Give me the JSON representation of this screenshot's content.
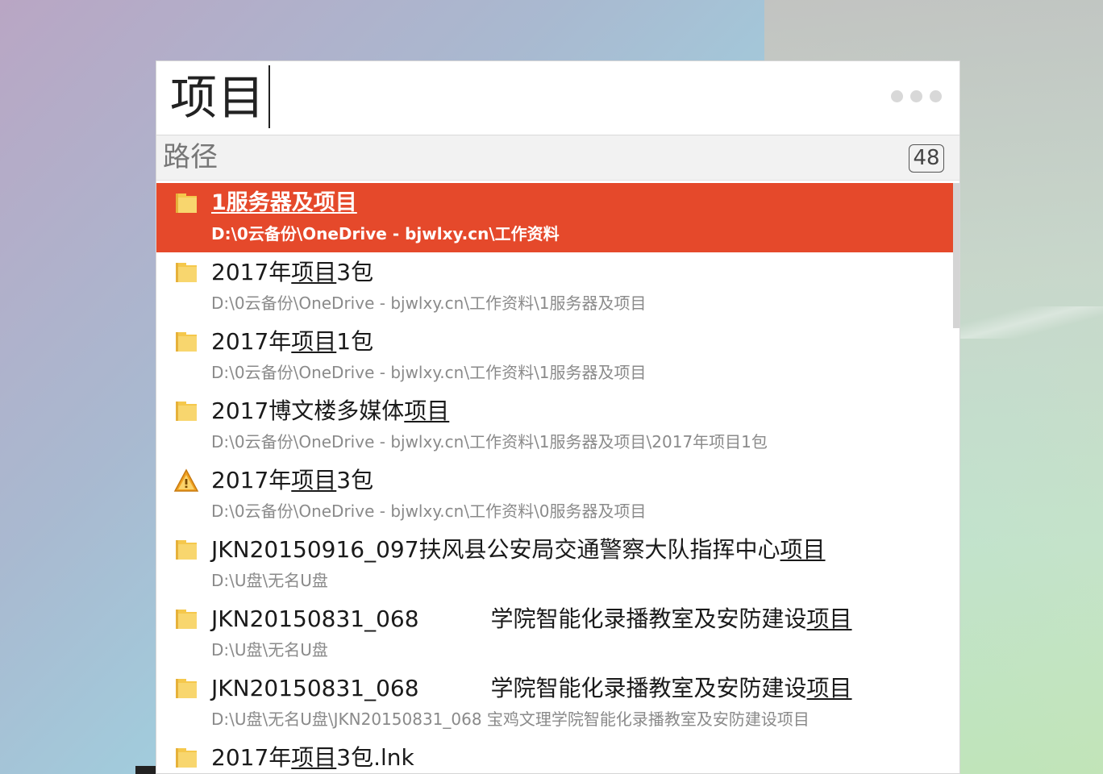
{
  "search": {
    "query": "项目"
  },
  "category": {
    "label": "路径",
    "count": "48"
  },
  "colors": {
    "selected_bg": "#e5492b",
    "folder_yellow": "#f5c84c",
    "warning_orange": "#f0a020"
  },
  "results": [
    {
      "icon": "folder-icon",
      "title_before": "",
      "title_match": "1服务器及项目",
      "title_after": "",
      "path": "D:\\0云备份\\OneDrive - bjwlxy.cn\\工作资料",
      "selected": true
    },
    {
      "icon": "folder-icon",
      "title_before": "2017年",
      "title_match": "项目",
      "title_after": "3包",
      "path": "D:\\0云备份\\OneDrive - bjwlxy.cn\\工作资料\\1服务器及项目"
    },
    {
      "icon": "folder-icon",
      "title_before": "2017年",
      "title_match": "项目",
      "title_after": "1包",
      "path": "D:\\0云备份\\OneDrive - bjwlxy.cn\\工作资料\\1服务器及项目"
    },
    {
      "icon": "folder-icon",
      "title_before": "2017博文楼多媒体",
      "title_match": "项目",
      "title_after": "",
      "path": "D:\\0云备份\\OneDrive - bjwlxy.cn\\工作资料\\1服务器及项目\\2017年项目1包"
    },
    {
      "icon": "warning-icon",
      "title_before": "2017年",
      "title_match": "项目",
      "title_after": "3包",
      "path": "D:\\0云备份\\OneDrive - bjwlxy.cn\\工作资料\\0服务器及项目"
    },
    {
      "icon": "folder-icon",
      "title_before": "JKN20150916_097扶风县公安局交通警察大队指挥中心",
      "title_match": "项目",
      "title_after": "",
      "path": "D:\\U盘\\无名U盘"
    },
    {
      "icon": "folder-icon",
      "title_before": "JKN20150831_068          学院智能化录播教室及安防建设",
      "title_match": "项目",
      "title_after": "",
      "path": "D:\\U盘\\无名U盘"
    },
    {
      "icon": "folder-icon",
      "title_before": "JKN20150831_068          学院智能化录播教室及安防建设",
      "title_match": "项目",
      "title_after": "",
      "path": "D:\\U盘\\无名U盘\\JKN20150831_068 宝鸡文理学院智能化录播教室及安防建设项目"
    },
    {
      "icon": "folder-icon",
      "title_before": "2017年",
      "title_match": "项目",
      "title_after": "3包.lnk",
      "path": ""
    }
  ]
}
